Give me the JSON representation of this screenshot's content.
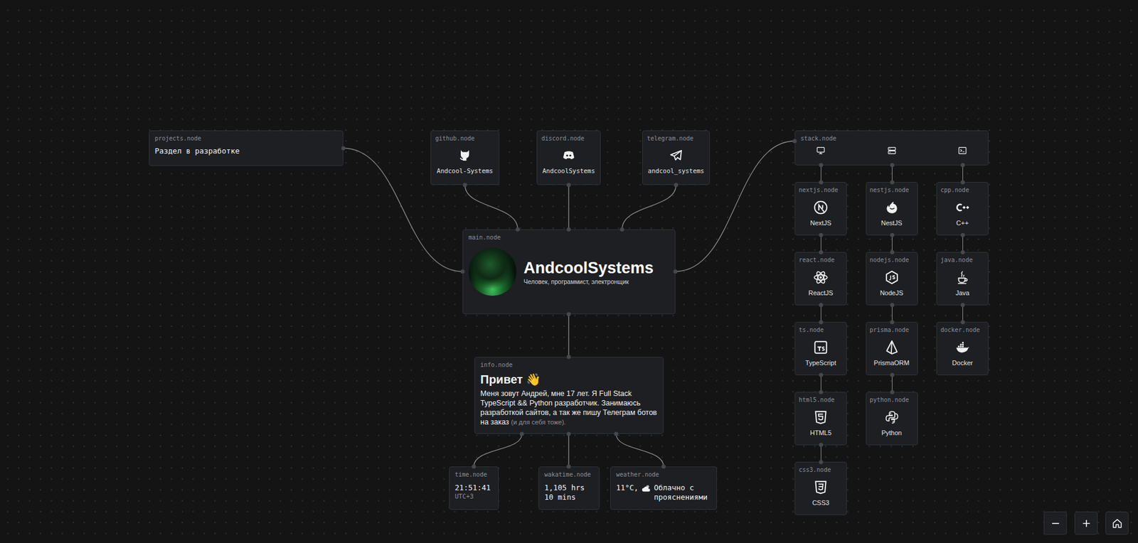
{
  "projects": {
    "label": "projects.node",
    "text": "Раздел в разработке"
  },
  "socials": [
    {
      "label": "github.node",
      "handle": "Andcool-Systems"
    },
    {
      "label": "discord.node",
      "handle": "AndcoolSystems"
    },
    {
      "label": "telegram.node",
      "handle": "andcool_systems"
    }
  ],
  "main": {
    "label": "main.node",
    "title": "AndcoolSystems",
    "subtitle": "Человек, программист, электронщик"
  },
  "info": {
    "label": "info.node",
    "heading": "Привет",
    "heading_icon": "👋",
    "text": "Меня зовут Андрей, мне 17 лет. Я Full Stack TypeScript && Python разработчик. Занимаюсь разработкой сайтов, а так же пишу Телеграм ботов на заказ",
    "note": "(и для себя тоже)."
  },
  "time": {
    "label": "time.node",
    "value": "21:51:41",
    "zone": "UTC+3"
  },
  "wakatime": {
    "label": "wakatime.node",
    "value": "1,105 hrs 10 mins"
  },
  "weather": {
    "label": "weather.node",
    "temperature": "11°C,",
    "description": "Облачно с прояснениями"
  },
  "stack": {
    "label": "stack.node",
    "columns": [
      {
        "items": [
          {
            "label": "nextjs.node",
            "name": "NextJS"
          },
          {
            "label": "react.node",
            "name": "ReactJS"
          },
          {
            "label": "ts.node",
            "name": "TypeScript"
          },
          {
            "label": "html5.node",
            "name": "HTML5"
          },
          {
            "label": "css3.node",
            "name": "CSS3"
          }
        ]
      },
      {
        "items": [
          {
            "label": "nestjs.node",
            "name": "NestJS"
          },
          {
            "label": "nodejs.node",
            "name": "NodeJS"
          },
          {
            "label": "prisma.node",
            "name": "PrismaORM"
          },
          {
            "label": "python.node",
            "name": "Python"
          }
        ]
      },
      {
        "items": [
          {
            "label": "cpp.node",
            "name": "C++"
          },
          {
            "label": "java.node",
            "name": "Java"
          },
          {
            "label": "docker.node",
            "name": "Docker"
          }
        ]
      }
    ]
  }
}
